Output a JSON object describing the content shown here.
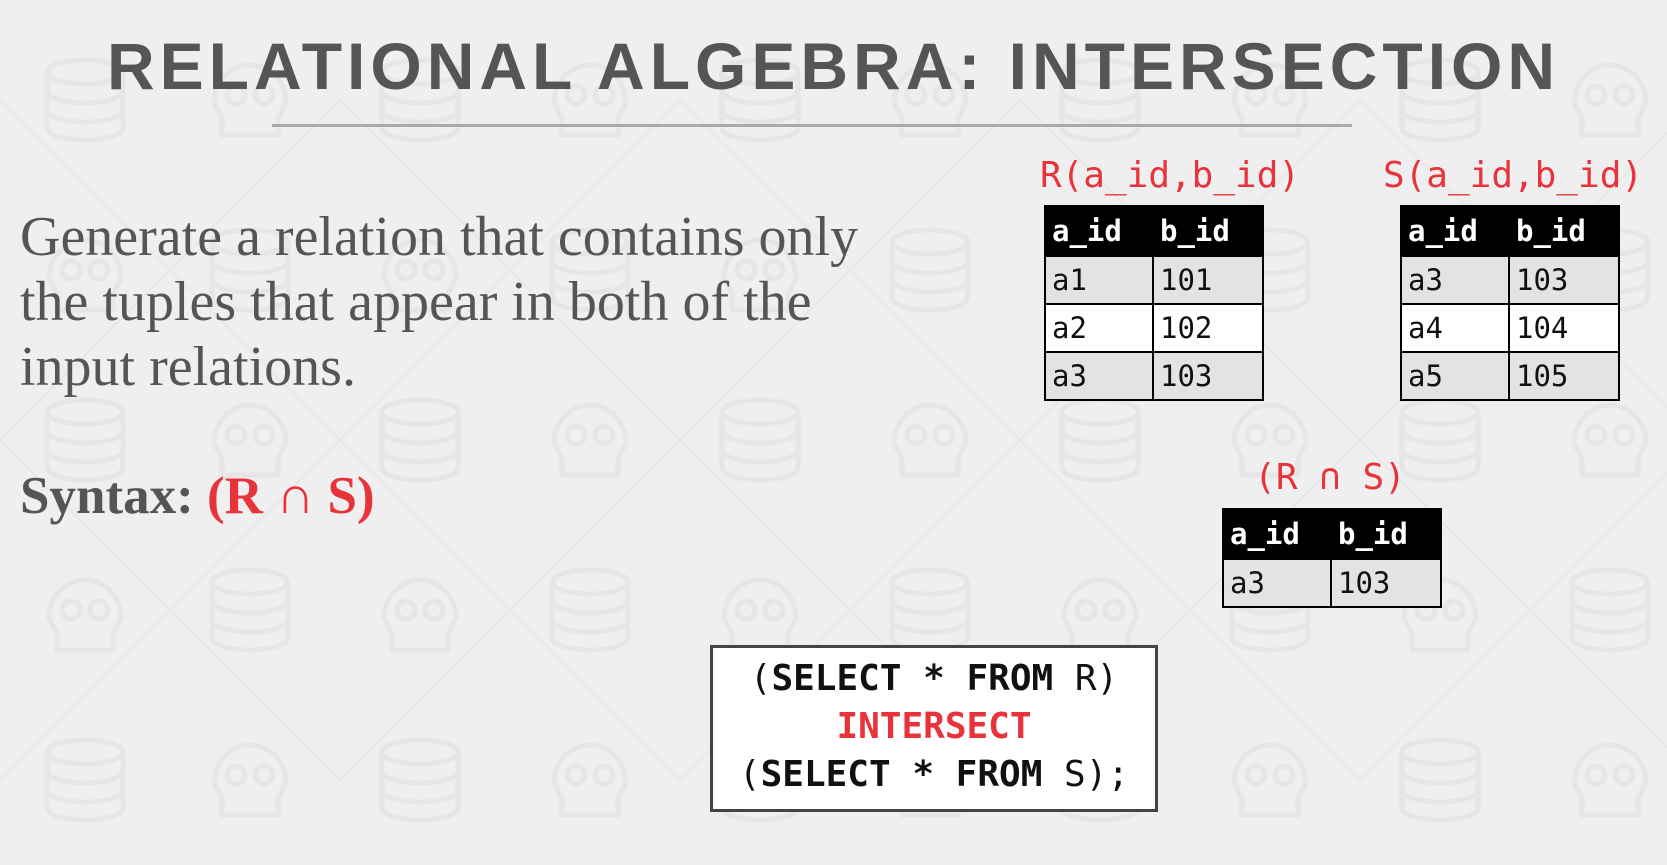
{
  "slide": {
    "title": "RELATIONAL ALGEBRA: INTERSECTION",
    "description": "Generate a relation that contains only the tuples that appear in both of the input relations.",
    "syntax_label": "Syntax: ",
    "syntax_expr": "(R ∩ S)"
  },
  "relations": {
    "r": {
      "label": "R(a_id,b_id)",
      "headers": [
        "a_id",
        "b_id"
      ],
      "rows": [
        [
          "a1",
          "101"
        ],
        [
          "a2",
          "102"
        ],
        [
          "a3",
          "103"
        ]
      ]
    },
    "s": {
      "label": "S(a_id,b_id)",
      "headers": [
        "a_id",
        "b_id"
      ],
      "rows": [
        [
          "a3",
          "103"
        ],
        [
          "a4",
          "104"
        ],
        [
          "a5",
          "105"
        ]
      ]
    },
    "result": {
      "label": "(R ∩ S)",
      "headers": [
        "a_id",
        "b_id"
      ],
      "rows": [
        [
          "a3",
          "103"
        ]
      ]
    }
  },
  "sql": {
    "line1_open": "(",
    "line1_kw": "SELECT * FROM",
    "line1_rel": " R)",
    "line2": "INTERSECT",
    "line3_open": "(",
    "line3_kw": "SELECT * FROM",
    "line3_rel": " S);"
  },
  "colors": {
    "accent": "#e8333a",
    "title": "#555555",
    "background": "#efefef"
  }
}
